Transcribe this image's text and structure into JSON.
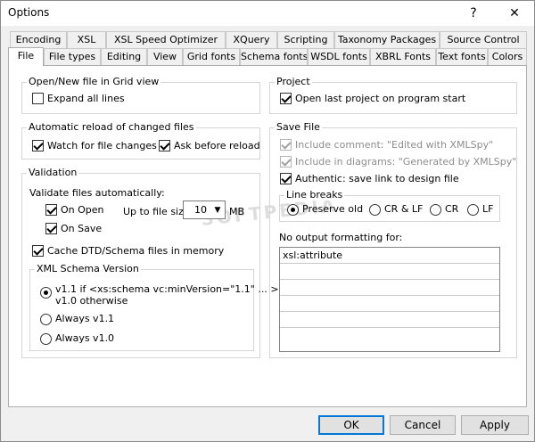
{
  "window": {
    "title": "Options",
    "help_glyph": "?",
    "close_glyph": "✕"
  },
  "tabs_row_back": [
    {
      "label": "Encoding"
    },
    {
      "label": "XSL"
    },
    {
      "label": "XSL Speed Optimizer"
    },
    {
      "label": "XQuery"
    },
    {
      "label": "Scripting"
    },
    {
      "label": "Taxonomy Packages"
    },
    {
      "label": "Source Control"
    }
  ],
  "tabs_row_front": [
    {
      "label": "File",
      "active": true
    },
    {
      "label": "File types"
    },
    {
      "label": "Editing"
    },
    {
      "label": "View"
    },
    {
      "label": "Grid fonts"
    },
    {
      "label": "Schema fonts"
    },
    {
      "label": "WSDL fonts"
    },
    {
      "label": "XBRL Fonts"
    },
    {
      "label": "Text fonts"
    },
    {
      "label": "Colors"
    }
  ],
  "open_new": {
    "title": "Open/New file in Grid view",
    "expand_all": {
      "label": "Expand all lines",
      "checked": false
    }
  },
  "auto_reload": {
    "title": "Automatic reload of changed files",
    "watch": {
      "label": "Watch for file changes",
      "checked": true
    },
    "ask": {
      "label": "Ask before reload",
      "checked": true
    }
  },
  "validation": {
    "title": "Validation",
    "auto_label": "Validate files automatically:",
    "on_open": {
      "label": "On Open",
      "checked": true
    },
    "on_save": {
      "label": "On Save",
      "checked": true
    },
    "size_label": "Up to file size",
    "size_value": "10",
    "size_unit": "MB",
    "cache": {
      "label": "Cache DTD/Schema files in memory",
      "checked": true
    },
    "schema_version": {
      "title": "XML Schema Version",
      "opt1_line1": "v1.1 if <xs:schema vc:minVersion=\"1.1\" ... >",
      "opt1_line2": "v1.0 otherwise",
      "opt2": "Always v1.1",
      "opt3": "Always v1.0",
      "selected": "opt1"
    }
  },
  "project": {
    "title": "Project",
    "open_last": {
      "label": "Open last project on program start",
      "checked": true
    }
  },
  "save_file": {
    "title": "Save File",
    "include_comment": {
      "label": "Include comment: \"Edited with XMLSpy\"",
      "checked": true,
      "disabled": true
    },
    "include_diagrams": {
      "label": "Include in diagrams: \"Generated by XMLSpy\"",
      "checked": true,
      "disabled": true
    },
    "authentic": {
      "label": "Authentic: save link to design file",
      "checked": true
    },
    "line_breaks": {
      "title": "Line breaks",
      "options": [
        "Preserve old",
        "CR & LF",
        "CR",
        "LF"
      ],
      "selected": "Preserve old"
    },
    "no_format_label": "No output formatting for:",
    "no_format_rows": [
      "xsl:attribute",
      "",
      "",
      "",
      "",
      ""
    ]
  },
  "watermark": "SOFTPEDIA",
  "buttons": {
    "ok": "OK",
    "cancel": "Cancel",
    "apply": "Apply"
  }
}
